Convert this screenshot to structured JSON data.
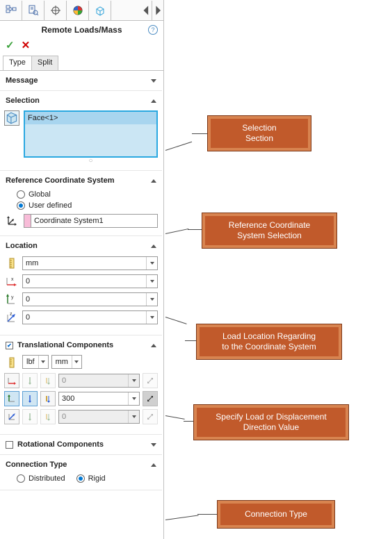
{
  "header": {
    "title": "Remote Loads/Mass"
  },
  "tabs": {
    "type": "Type",
    "split": "Split"
  },
  "sections": {
    "message": "Message",
    "selection": {
      "title": "Selection",
      "items": [
        "Face<1>"
      ]
    },
    "refCoord": {
      "title": "Reference Coordinate System",
      "options": {
        "global": "Global",
        "user": "User defined"
      },
      "value": "Coordinate System1"
    },
    "location": {
      "title": "Location",
      "unit": "mm",
      "x": "0",
      "y": "0",
      "z": "0"
    },
    "trans": {
      "title": "Translational Components",
      "forceUnit": "lbf",
      "lengthUnit": "mm",
      "row1": "0",
      "row2": "300",
      "row3": "0"
    },
    "rot": {
      "title": "Rotational Components"
    },
    "conn": {
      "title": "Connection Type",
      "options": {
        "distributed": "Distributed",
        "rigid": "Rigid"
      }
    }
  },
  "callouts": {
    "selection": "Selection\nSection",
    "refCoord": "Reference Coordinate\nSystem Selection",
    "location": "Load Location Regarding\nto the Coordinate System",
    "trans": "Specify Load or Displacement\nDirection Value",
    "conn": "Connection Type"
  }
}
